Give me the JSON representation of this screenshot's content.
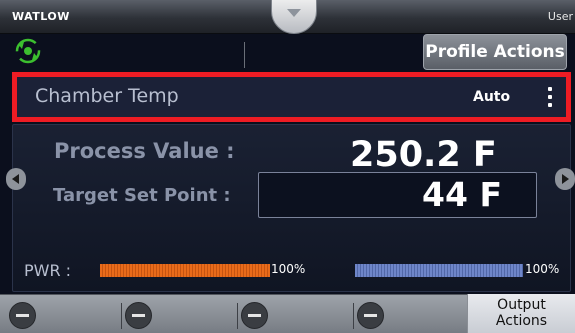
{
  "header": {
    "brand": "WATLOW",
    "user": "User"
  },
  "toolbar": {
    "profile_actions_label": "Profile Actions"
  },
  "chamber": {
    "name": "Chamber Temp",
    "mode": "Auto"
  },
  "readings": {
    "process_value_label": "Process Value :",
    "process_value": "250.2 F",
    "target_setpoint_label": "Target Set Point :",
    "target_setpoint": "44 F"
  },
  "power": {
    "label": "PWR :",
    "output1_percent": "100%",
    "output1_level": 1.0,
    "output2_percent": "100%",
    "output2_level": 1.0
  },
  "bottom": {
    "output_actions_label_line1": "Output",
    "output_actions_label_line2": "Actions"
  },
  "colors": {
    "highlight": "#ee1c24",
    "pwr_bar_1": "#e96b1a",
    "pwr_bar_2": "#6f86c9",
    "sync_icon": "#3cbf2f"
  },
  "icons": [
    "sync-icon",
    "kebab-menu-icon",
    "chevron-left-icon",
    "chevron-right-icon",
    "minus-icon",
    "tab-down-arrow-icon"
  ]
}
